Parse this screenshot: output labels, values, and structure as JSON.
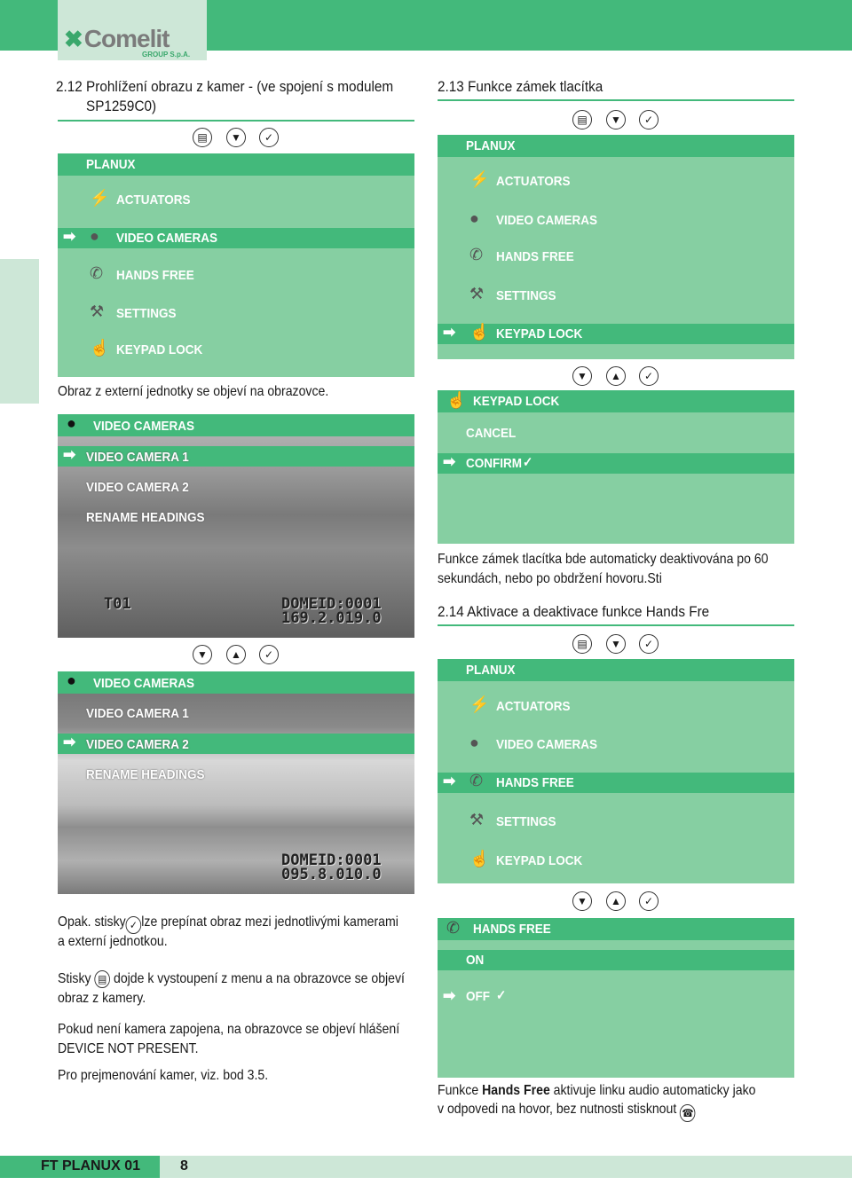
{
  "header": {
    "logo_text": "Comelit",
    "logo_sub": "GROUP S.p.A."
  },
  "colors": {
    "brand": "#43b97b",
    "panel": "#86cfa2",
    "light": "#cde7d7"
  },
  "left": {
    "title_line1": "2.12 Prohlížení obrazu z kamer - (ve spojení s modulem",
    "title_line2": "SP1259C0)",
    "menu": {
      "buttons": [
        "menu-icon",
        "down-icon",
        "confirm-icon"
      ],
      "header": "PLANUX",
      "items": [
        {
          "label": "ACTUATORS",
          "icon": "actuators-icon"
        },
        {
          "label": "VIDEO CAMERAS",
          "icon": "eye-icon",
          "selected": true
        },
        {
          "label": "HANDS FREE",
          "icon": "phone-icon"
        },
        {
          "label": "SETTINGS",
          "icon": "wrench-icon"
        },
        {
          "label": "KEYPAD LOCK",
          "icon": "hand-icon"
        }
      ]
    },
    "caption1": "Obraz z externí jednotky se objeví na obrazovce.",
    "cam1": {
      "header": "VIDEO CAMERAS",
      "items": [
        "VIDEO CAMERA 1",
        "VIDEO CAMERA 2",
        "RENAME HEADINGS"
      ],
      "selected": 0,
      "osd_left": "T01",
      "osd_line1": "DOMEID:0001",
      "osd_line2": "169.2.019.0"
    },
    "cam2_buttons": [
      "down-icon",
      "up-icon",
      "confirm-icon"
    ],
    "cam2": {
      "header": "VIDEO CAMERAS",
      "items": [
        "VIDEO CAMERA 1",
        "VIDEO CAMERA 2",
        "RENAME HEADINGS"
      ],
      "selected": 1,
      "osd_line1": "DOMEID:0001",
      "osd_line2": "095.8.010.0"
    },
    "para1a": "Opak. stisky",
    "para1b": "lze prepínat obraz mezi jednotlivými kamerami",
    "para1c": "a externí jednotkou.",
    "para2a": "Stisky",
    "para2b": "dojde k vystoupení z menu a na obrazovce se objeví",
    "para2c": "obraz z kamery.",
    "para3a": "Pokud není kamera zapojena, na obrazovce se objeví hlášení",
    "para3b": "DEVICE NOT PRESENT.",
    "para4": "Pro prejmenování kamer, viz. bod 3.5."
  },
  "right": {
    "title213": "2.13 Funkce zámek tlacítka",
    "menu213": {
      "header": "PLANUX",
      "items": [
        "ACTUATORS",
        "VIDEO CAMERAS",
        "HANDS FREE",
        "SETTINGS",
        "KEYPAD LOCK"
      ],
      "selected": 4
    },
    "lock": {
      "header": "KEYPAD LOCK",
      "items": [
        "CANCEL",
        "CONFIRM"
      ],
      "selected": 1
    },
    "text213a": "Funkce zámek tlacítka bde automaticky deaktivována po 60",
    "text213b": "sekundách, nebo po obdržení hovoru.Sti",
    "title214": "2.14 Aktivace a deaktivace funkce Hands Fre",
    "menu214": {
      "header": "PLANUX",
      "items": [
        "ACTUATORS",
        "VIDEO CAMERAS",
        "HANDS FREE",
        "SETTINGS",
        "KEYPAD LOCK"
      ],
      "selected": 2
    },
    "hf": {
      "header": "HANDS FREE",
      "items": [
        "ON",
        "OFF"
      ],
      "selected": 0
    },
    "text214a_pre": "Funkce ",
    "text214a_bold": "Hands Free",
    "text214a_post": " aktivuje linku audio automaticky jako",
    "text214b": "v odpovedi na hovor, bez nutnosti stisknout"
  },
  "footer": {
    "doc": "FT PLANUX 01",
    "page": "8"
  }
}
